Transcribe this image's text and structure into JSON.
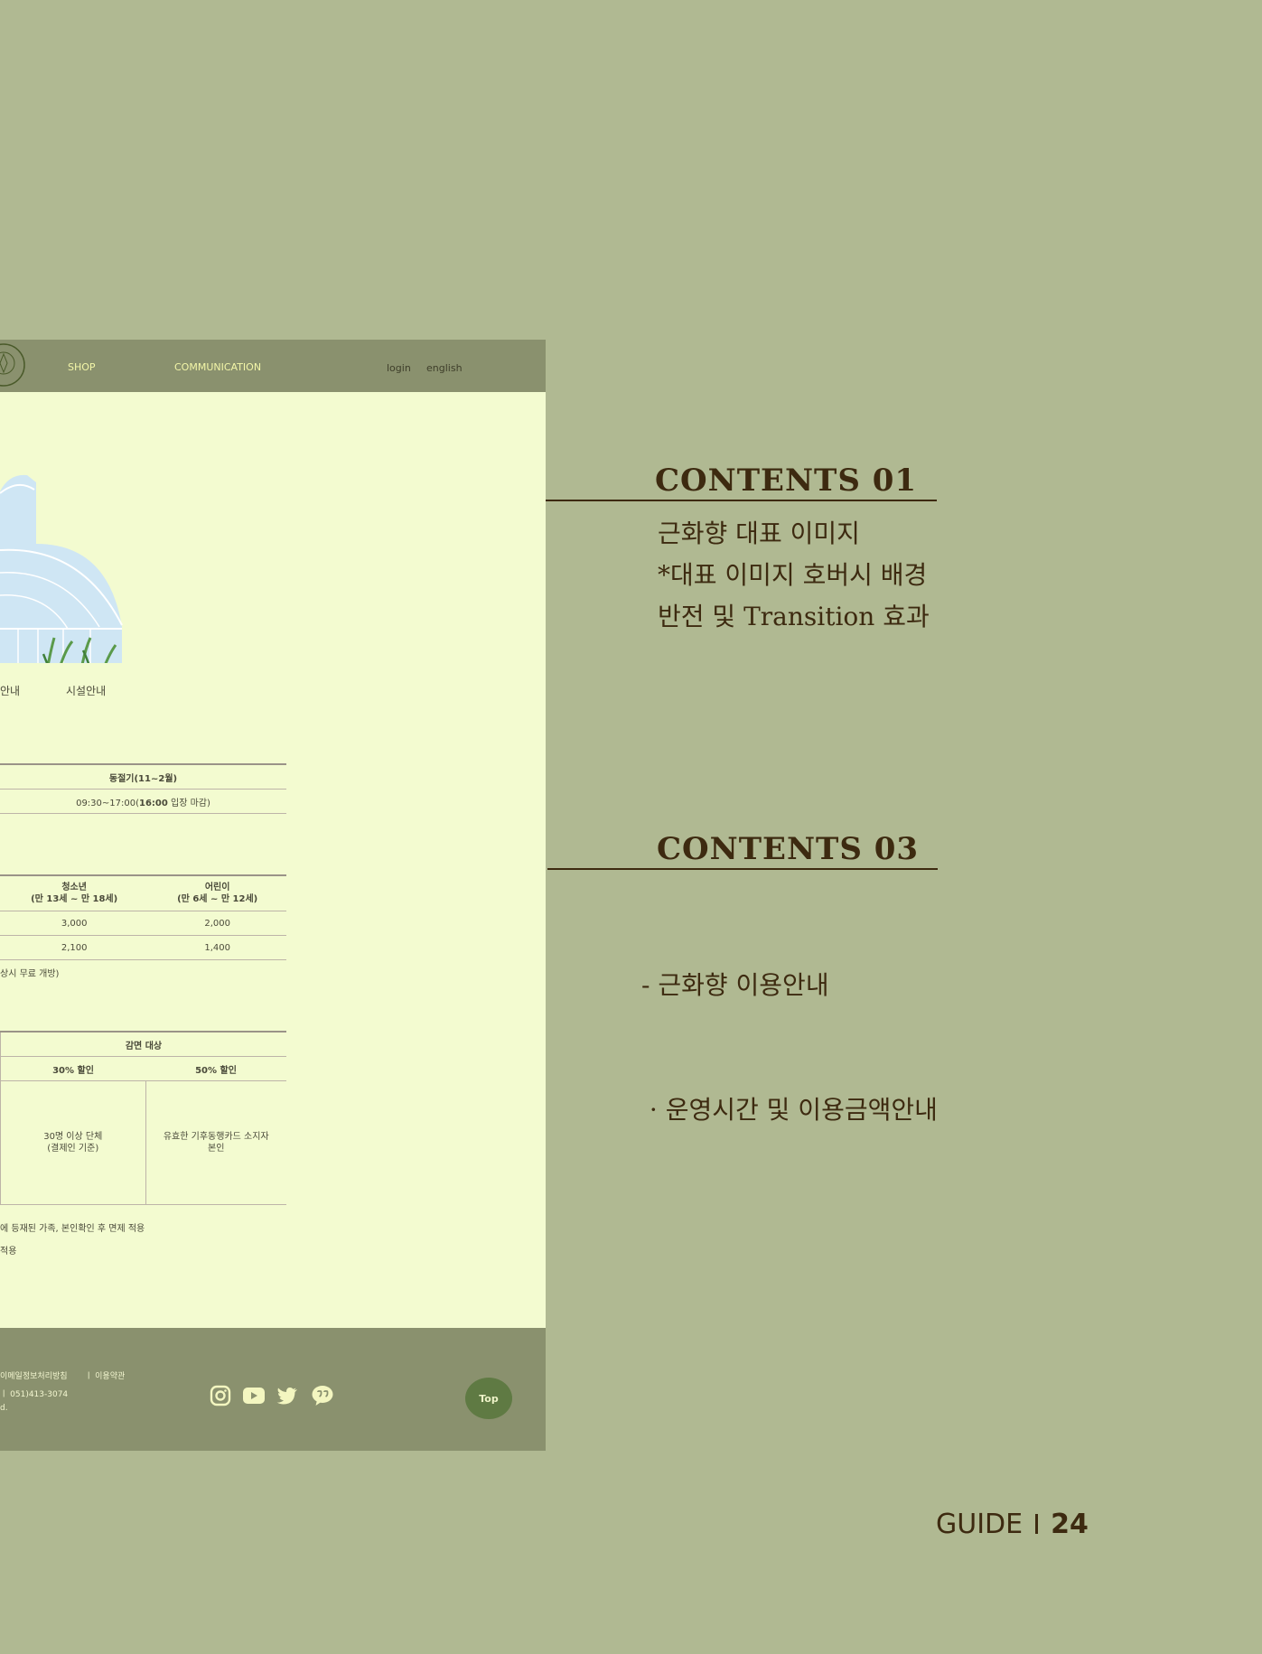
{
  "nav": {
    "links": [
      "SHOP",
      "COMMUNICATION"
    ],
    "login": "login",
    "english": "english"
  },
  "tabs": [
    "안내",
    "시설안내"
  ],
  "hours_table": {
    "header": "동절기(11~2월)",
    "row": [
      "09:30~17:00(",
      "16:00",
      " 입장 마감)"
    ]
  },
  "fee_table": {
    "headers": [
      [
        "청소년",
        "(만 13세 ~ 만 18세)"
      ],
      [
        "어린이",
        "(만 6세 ~ 만 12세)"
      ]
    ],
    "rows": [
      [
        "3,000",
        "2,000"
      ],
      [
        "2,100",
        "1,400"
      ]
    ],
    "note": "상시 무료 개방)"
  },
  "discount_table": {
    "header": "감면 대상",
    "sub_headers": [
      "30% 할인",
      "50% 할인"
    ],
    "cells": [
      [
        "30명 이상 단체",
        "(결제인 기준)"
      ],
      [
        "유효한 기후동행카드 소지자",
        "본인"
      ]
    ],
    "notes": [
      "에 등재된 가족, 본인확인 후 면제 적용",
      "적용"
    ]
  },
  "footer": {
    "links": [
      "이메일정보처리방침",
      "ㅣ 이용약관"
    ],
    "phone": "ㅣ 051)413-3074",
    "copyright": "d.",
    "top_button": "Top"
  },
  "contents": [
    {
      "title": "CONTENTS 01",
      "lines": [
        "근화향 대표 이미지",
        "*대표 이미지 호버시 배경",
        "반전 및 Transition 효과"
      ]
    },
    {
      "title": "CONTENTS 03",
      "lines": [
        "- 근화향 이용안내",
        " · 운영시간 및 이용금액안내"
      ]
    }
  ],
  "page_footer": {
    "label": "GUIDE",
    "number": "24"
  },
  "colors": {
    "background": "#b0b992",
    "nav": "#8a916e",
    "content_bg": "#f3fbd0",
    "accent_text": "#3d2a10",
    "top_button": "#5f7a43"
  },
  "icons": [
    "instagram-icon",
    "youtube-icon",
    "twitter-icon",
    "kakaotalk-icon"
  ]
}
